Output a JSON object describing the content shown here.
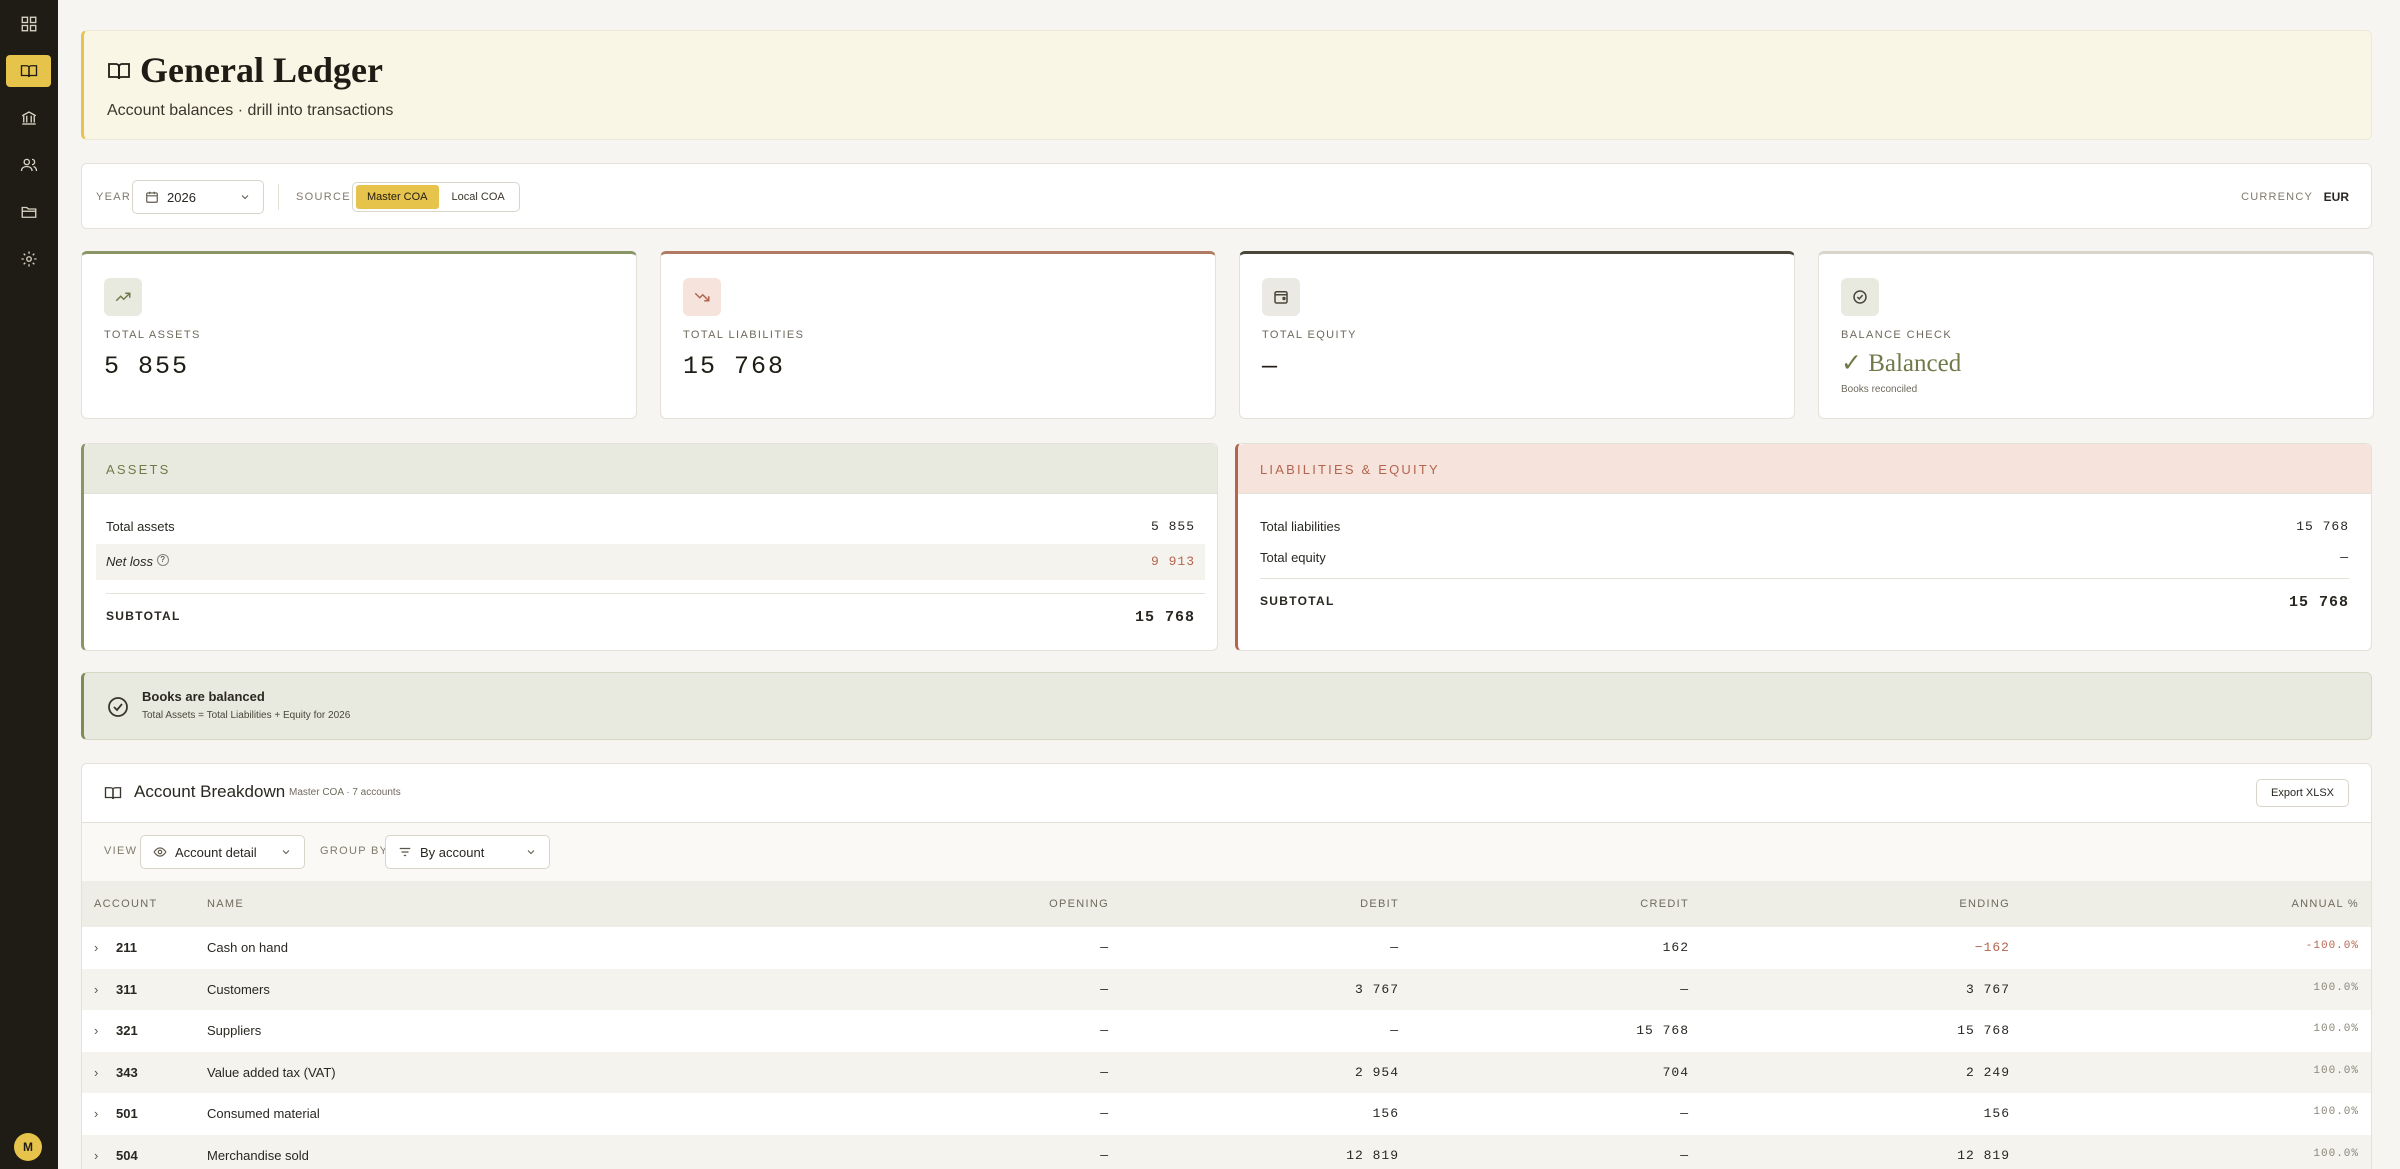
{
  "sidebar": {
    "items": [
      {
        "icon": "dashboard-icon",
        "active": false
      },
      {
        "icon": "book-icon",
        "active": true
      },
      {
        "icon": "bank-icon",
        "active": false
      },
      {
        "icon": "users-icon",
        "active": false
      },
      {
        "icon": "folder-icon",
        "active": false
      },
      {
        "icon": "gear-icon",
        "active": false
      }
    ],
    "avatar_initial": "M"
  },
  "header": {
    "title": "General Ledger",
    "subtitle": "Account balances · drill into transactions"
  },
  "filters": {
    "year_label": "YEAR",
    "year_value": "2026",
    "source_label": "SOURCE",
    "source_options": [
      "Master COA",
      "Local COA"
    ],
    "source_selected": "Master COA",
    "currency_label": "CURRENCY",
    "currency_value": "EUR"
  },
  "kpis": [
    {
      "label": "TOTAL ASSETS",
      "value": "5 855",
      "icon": "trending-up-icon",
      "accent": "#8a9566"
    },
    {
      "label": "TOTAL LIABILITIES",
      "value": "15 768",
      "icon": "trending-down-icon",
      "accent": "#b07a63"
    },
    {
      "label": "TOTAL EQUITY",
      "value": "—",
      "icon": "wallet-icon",
      "accent": "#4a4639"
    },
    {
      "label": "BALANCE CHECK",
      "value": "✓ Balanced",
      "sub": "Books reconciled",
      "icon": "check-circle-icon",
      "accent": "#7f8a56"
    }
  ],
  "assets": {
    "title": "ASSETS",
    "rows": [
      {
        "label": "Total assets",
        "value": "5 855"
      },
      {
        "label": "Net loss",
        "value": "9 913"
      }
    ],
    "subtotal_label": "SUBTOTAL",
    "subtotal_value": "15 768"
  },
  "liabilities": {
    "title": "LIABILITIES & EQUITY",
    "rows": [
      {
        "label": "Total liabilities",
        "value": "15 768"
      },
      {
        "label": "Total equity",
        "value": "—"
      }
    ],
    "subtotal_label": "SUBTOTAL",
    "subtotal_value": "15 768"
  },
  "banner": {
    "title": "Books are balanced",
    "text": "Total Assets = Total Liabilities + Equity for 2026"
  },
  "breakdown": {
    "title": "Account Breakdown",
    "meta": "Master COA · 7 accounts",
    "export_label": "Export XLSX",
    "view_label": "VIEW",
    "view_value": "Account detail",
    "group_label": "GROUP BY",
    "group_value": "By account",
    "columns": [
      "ACCOUNT",
      "NAME",
      "OPENING",
      "DEBIT",
      "CREDIT",
      "ENDING",
      "ANNUAL %"
    ],
    "rows": [
      {
        "account": "211",
        "name": "Cash on hand",
        "opening": "—",
        "debit": "—",
        "credit": "162",
        "ending": "−162",
        "annual": "-100.0%"
      },
      {
        "account": "311",
        "name": "Customers",
        "opening": "—",
        "debit": "3 767",
        "credit": "—",
        "ending": "3 767",
        "annual": "100.0%"
      },
      {
        "account": "321",
        "name": "Suppliers",
        "opening": "—",
        "debit": "—",
        "credit": "15 768",
        "ending": "15 768",
        "annual": "100.0%"
      },
      {
        "account": "343",
        "name": "Value added tax (VAT)",
        "opening": "—",
        "debit": "2 954",
        "credit": "704",
        "ending": "2 249",
        "annual": "100.0%"
      },
      {
        "account": "501",
        "name": "Consumed material",
        "opening": "—",
        "debit": "156",
        "credit": "—",
        "ending": "156",
        "annual": "100.0%"
      },
      {
        "account": "504",
        "name": "Merchandise sold",
        "opening": "—",
        "debit": "12 819",
        "credit": "—",
        "ending": "12 819",
        "annual": "100.0%"
      }
    ]
  },
  "colors": {
    "accent_gold": "#e6c34a",
    "assets_green": "#7f8a56",
    "liabilities_red": "#b5654f",
    "negative_red": "#b5654f"
  }
}
